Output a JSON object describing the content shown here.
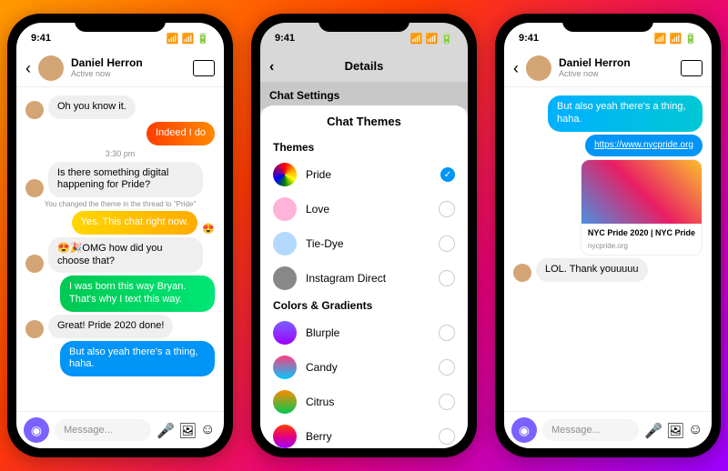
{
  "status": {
    "time": "9:41"
  },
  "contact": {
    "name": "Daniel Herron",
    "status": "Active now"
  },
  "chat1": {
    "m1": "Oh you know it.",
    "m2": "Indeed I do",
    "ts": "3:30 pm",
    "m3": "Is there something digital happening for Pride?",
    "sys": "You changed the theme in the thread to \"Pride\"",
    "m4": "Yes. This chat right now.",
    "m5": "😍🎉OMG how did you choose that?",
    "m6": "I was born this way Bryan. That's why I text this way.",
    "m7": "Great! Pride 2020 done!",
    "m8": "But also yeah there's a thing, haha."
  },
  "composer": {
    "placeholder": "Message..."
  },
  "details": {
    "title": "Details",
    "section": "Chat Settings",
    "sheet_title": "Chat Themes",
    "themes_label": "Themes",
    "colors_label": "Colors & Gradients",
    "themes": [
      "Pride",
      "Love",
      "Tie-Dye",
      "Instagram Direct"
    ],
    "colors": [
      "Blurple",
      "Candy",
      "Citrus",
      "Berry"
    ]
  },
  "chat3": {
    "m1": "But also yeah there's a thing, haha.",
    "link": "https://www.nycpride.org",
    "card_title": "NYC Pride 2020 | NYC Pride",
    "card_sub": "nycpride.org",
    "m2": "LOL. Thank youuuuu"
  }
}
